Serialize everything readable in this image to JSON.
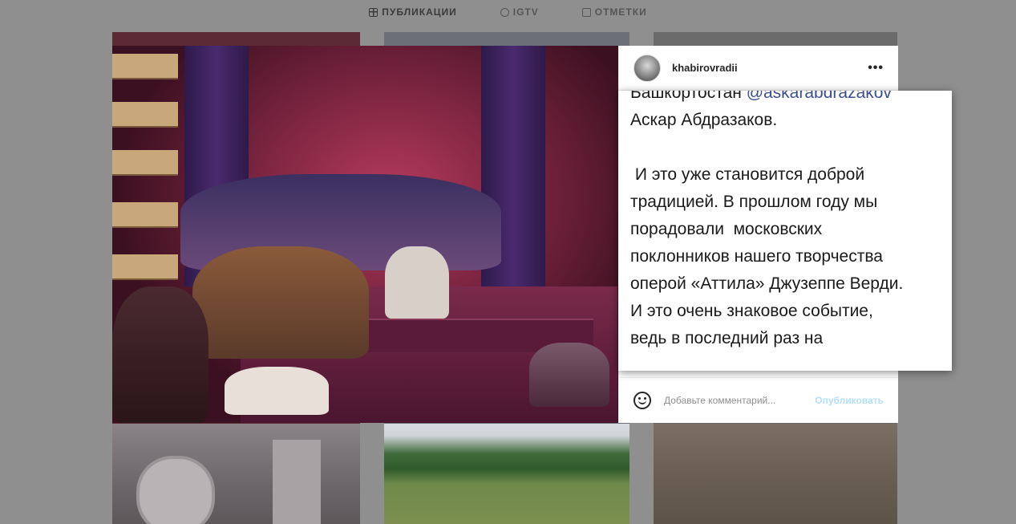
{
  "tabs": [
    {
      "label": "ПУБЛИКАЦИИ",
      "icon": "grid-icon",
      "active": true
    },
    {
      "label": "IGTV",
      "icon": "igtv-icon",
      "active": false
    },
    {
      "label": "ОТМЕТКИ",
      "icon": "tag-icon",
      "active": false
    }
  ],
  "post": {
    "username": "khabirovradii",
    "more": "•••",
    "caption": {
      "line1_prefix": "Башкортостан ",
      "line1_mention": "@askarabdrazakov",
      "line2": "Аскар Абдразаков.",
      "lines": [
        " И это уже становится доброй",
        "традицией. В прошлом году мы",
        "порадовали  московских",
        "поклонников нашего творчества",
        "оперой «Аттила» Джузеппе Верди.",
        "И это очень знаковое событие,",
        "ведь в последний раз на"
      ]
    },
    "comment_placeholder": "Добавьте комментарий...",
    "publish_label": "Опубликовать"
  },
  "colors": {
    "mention": "#3b4f8c",
    "publish": "#b2dffc",
    "overlay": "#8f8f8f"
  }
}
